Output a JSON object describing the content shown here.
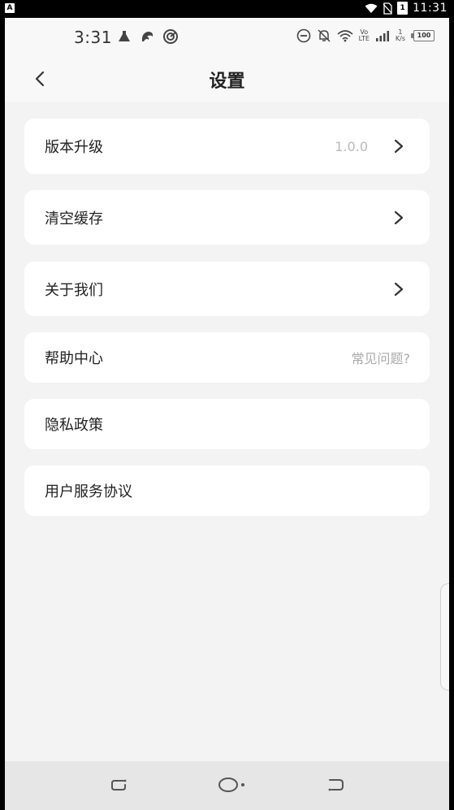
{
  "system_bar": {
    "badge": "A",
    "battery_level": "1",
    "time": "11:31",
    "icons": [
      "wifi-icon",
      "no-sim-icon",
      "battery-icon"
    ]
  },
  "status_bar": {
    "time": "3:31",
    "network_speed_value": "1",
    "network_speed_unit": "K/s",
    "battery_level": "100",
    "volte_top": "Vo",
    "volte_bottom": "LTE",
    "icons": [
      "notification-icon",
      "app-icon",
      "sync-icon",
      "dnd-icon",
      "mute-icon",
      "wifi-icon",
      "signal-icon",
      "battery-icon"
    ]
  },
  "header": {
    "title": "设置",
    "back_icon": "chevron-left-icon"
  },
  "settings": {
    "items": [
      {
        "label": "版本升级",
        "value": "1.0.0",
        "has_chevron": true
      },
      {
        "label": "清空缓存",
        "value": "",
        "has_chevron": true
      },
      {
        "label": "关于我们",
        "value": "",
        "has_chevron": true
      },
      {
        "label": "帮助中心",
        "value": "常见问题?",
        "has_chevron": false
      },
      {
        "label": "隐私政策",
        "value": "",
        "has_chevron": false
      },
      {
        "label": "用户服务协议",
        "value": "",
        "has_chevron": false
      }
    ]
  },
  "bottom_nav": {
    "icons": [
      "recent-apps-icon",
      "home-icon",
      "back-icon"
    ]
  },
  "colors": {
    "page_background": "#f3f3f3",
    "card_background": "#ffffff",
    "text_primary": "#222222",
    "text_secondary": "#b8b8b8"
  }
}
